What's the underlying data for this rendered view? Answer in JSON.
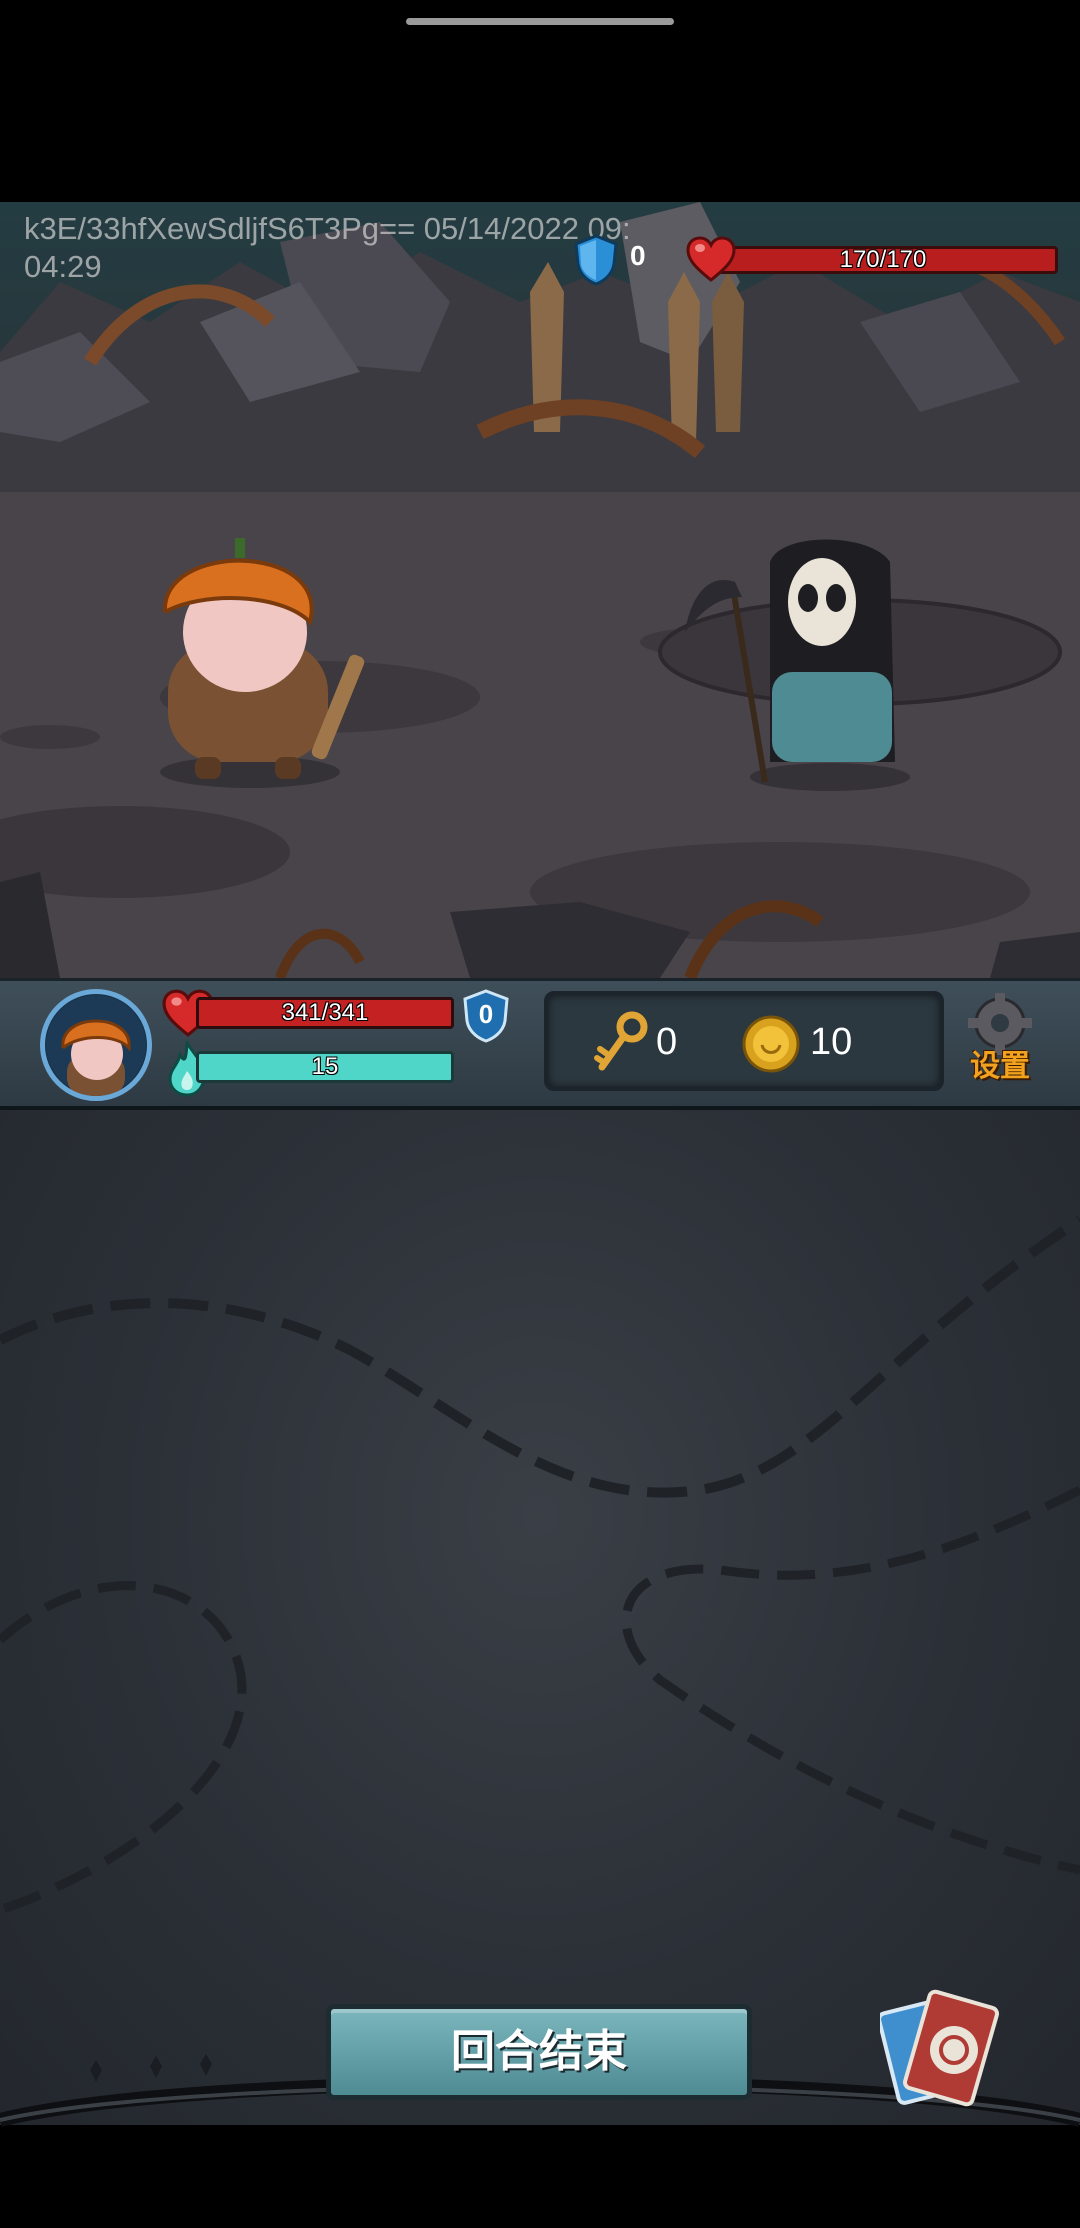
{
  "watermark": "k3E/33hfXewSdljfS6T3Pg== 05/14/2022 09:04:29",
  "enemy": {
    "shield": "0",
    "hp": "170/170",
    "hp_fraction": 1.0
  },
  "player": {
    "hp": "341/341",
    "hp_fraction": 1.0,
    "energy": "15",
    "energy_fraction": 1.0,
    "shield": "0"
  },
  "resources": {
    "keys": "0",
    "coins": "10"
  },
  "settings_label": "设置",
  "end_turn_label": "回合结束",
  "icons": {
    "shield": "shield-icon",
    "heart": "heart-icon",
    "flame": "mana-flame-icon",
    "key": "key-icon",
    "coin": "coin-icon",
    "gear": "gear-icon",
    "deck": "card-deck-icon"
  },
  "colors": {
    "hp_red": "#c42222",
    "energy_teal": "#4fd6c8",
    "shield_blue": "#2a8fd6",
    "settings_orange": "#f2a21e"
  }
}
